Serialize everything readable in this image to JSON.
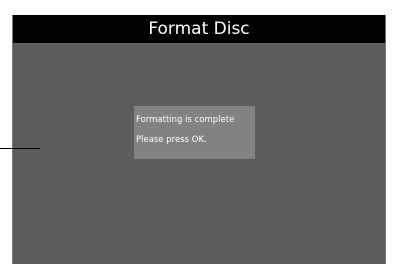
{
  "window": {
    "title": "Format Disc"
  },
  "dialog": {
    "line1": "Formatting is complete",
    "line2": "Please press OK."
  },
  "colors": {
    "title_bar": "#000000",
    "screen_background": "#5c5c5c",
    "dialog_background": "#828282",
    "text": "#ffffff"
  }
}
